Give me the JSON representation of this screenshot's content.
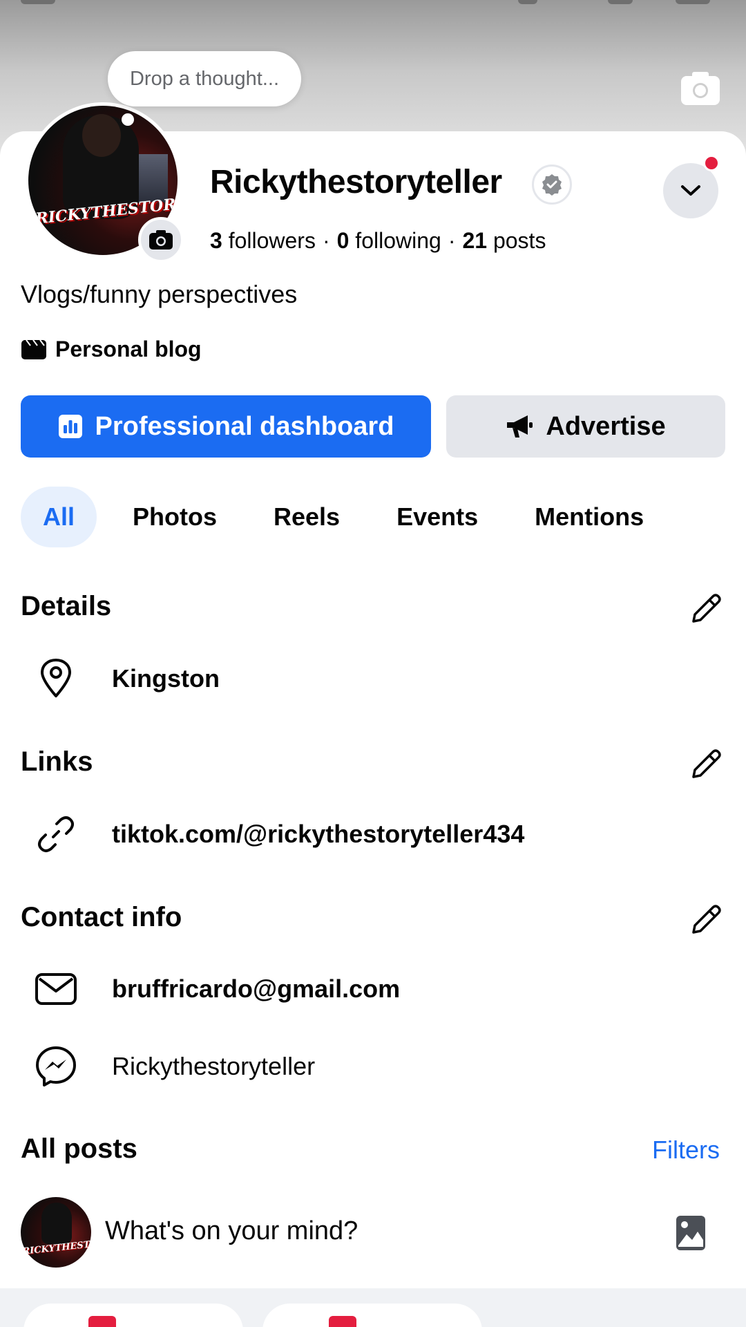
{
  "profile": {
    "thought_placeholder": "Drop a thought...",
    "name": "Rickythestoryteller",
    "avatar_text": "RICKYTHESTORYTELLER",
    "stats": {
      "followers_count": "3",
      "followers_label": "followers",
      "following_count": "0",
      "following_label": "following",
      "posts_count": "21",
      "posts_label": "posts",
      "separator": "·"
    },
    "bio": "Vlogs/funny perspectives",
    "category": "Personal blog"
  },
  "actions": {
    "primary_label": "Professional dashboard",
    "secondary_label": "Advertise"
  },
  "tabs": [
    {
      "label": "All",
      "active": true
    },
    {
      "label": "Photos",
      "active": false
    },
    {
      "label": "Reels",
      "active": false
    },
    {
      "label": "Events",
      "active": false
    },
    {
      "label": "Mentions",
      "active": false
    }
  ],
  "details": {
    "title": "Details",
    "location": "Kingston"
  },
  "links": {
    "title": "Links",
    "url": "tiktok.com/@rickythestoryteller434"
  },
  "contact": {
    "title": "Contact info",
    "email": "bruffricardo@gmail.com",
    "messenger": "Rickythestoryteller"
  },
  "posts": {
    "title": "All posts",
    "filters_label": "Filters",
    "composer_placeholder": "What's on your mind?"
  },
  "colors": {
    "accent": "#1b6cf2",
    "notification": "#e41e3f"
  },
  "icons": {
    "cover_camera": "camera-icon",
    "avatar_camera": "camera-icon",
    "verified": "verified-badge-icon",
    "dropdown": "chevron-down-icon",
    "category": "clapperboard-icon",
    "dashboard": "bar-chart-icon",
    "advertise": "megaphone-icon",
    "edit": "pencil-icon",
    "location": "location-pin-icon",
    "link": "link-icon",
    "email": "envelope-icon",
    "messenger": "messenger-icon",
    "photo": "photo-icon"
  }
}
